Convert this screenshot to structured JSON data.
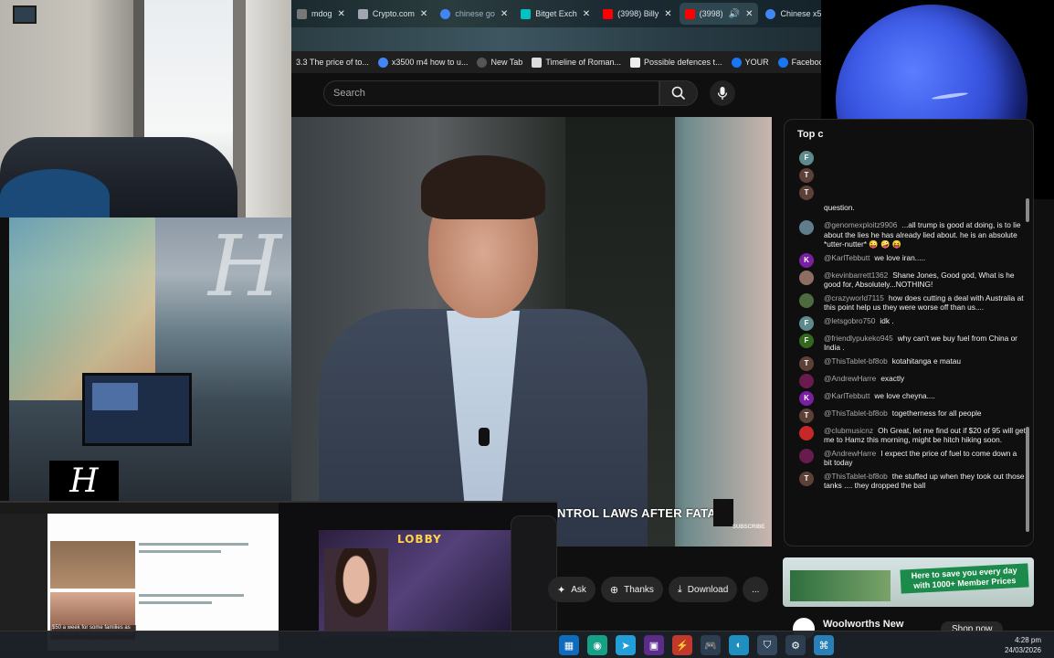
{
  "tabs": [
    {
      "label": "mdog",
      "color": "#777777"
    },
    {
      "label": "Crypto.com",
      "color": "#a1a6b4"
    },
    {
      "label": "chinese go",
      "color": "#4285f4"
    },
    {
      "label": "Bitget Exch",
      "color": "#00c2c2"
    },
    {
      "label": "(3998) Billy",
      "color": "#ff0000"
    },
    {
      "label": "(3998)",
      "color": "#ff0000"
    },
    {
      "label": "Chinese x5",
      "color": "#4285f4"
    }
  ],
  "bookmarks": [
    {
      "label": "3.3 The price of to...",
      "color": "#2e7d32"
    },
    {
      "label": "x3500 m4 how to u...",
      "color": "#4285f4"
    },
    {
      "label": "New Tab",
      "color": "#555555"
    },
    {
      "label": "Timeline of Roman...",
      "color": "#dddddd"
    },
    {
      "label": "Possible defences t...",
      "color": "#eeeeee"
    },
    {
      "label": "YOUR",
      "color": "#1877f2"
    },
    {
      "label": "Facebook green",
      "color": "#1877f2"
    }
  ],
  "search": {
    "placeholder": "Search"
  },
  "video": {
    "caption": "NTROL LAWS AFTER FATAL",
    "subscribe_mark": "SUBSCRIBE"
  },
  "mini": {
    "news_caption": "$50 a week for some families as fuel crisis relief package unveiled",
    "lobby_label": "LOBBY"
  },
  "actions": {
    "ask": "Ask",
    "thanks": "Thanks",
    "download": "Download",
    "more": "..."
  },
  "chat": {
    "header": "Top c",
    "messages": [
      {
        "avatar": "F",
        "color": "#5f8a8b",
        "author": "",
        "text": ""
      },
      {
        "avatar": "T",
        "color": "#5d4037",
        "author": "",
        "text": ""
      },
      {
        "avatar": "T",
        "color": "#5d4037",
        "author": "",
        "text": ""
      },
      {
        "avatar": "",
        "color": "#000000",
        "author": "",
        "text": "question."
      },
      {
        "avatar": "",
        "color": "#607d8b",
        "author": "@genomexploitz9906",
        "text": "...all trump is good at doing, is to lie about the lies he has already lied about. he is an absolute *utter-nutter* 😜 🤪 😝"
      },
      {
        "avatar": "K",
        "color": "#7b1fa2",
        "author": "@KarlTebbutt",
        "text": "we love iran....."
      },
      {
        "avatar": "",
        "color": "#8d6e63",
        "author": "@kevinbarrett1362",
        "text": "Shane Jones, Good god, What is he good for, Absolutely...NOTHING!"
      },
      {
        "avatar": "",
        "color": "#4e6b3f",
        "author": "@crazyworld7115",
        "text": "how does cutting a deal with Australia at this point help us they were worse off than us...."
      },
      {
        "avatar": "F",
        "color": "#5f8a8b",
        "author": "@letsgobro750",
        "text": "idk ."
      },
      {
        "avatar": "F",
        "color": "#33691e",
        "author": "@friendlypukeko945",
        "text": "why can't we buy fuel from China or India ."
      },
      {
        "avatar": "T",
        "color": "#5d4037",
        "author": "@ThisTablet-bf8ob",
        "text": "kotahitanga e matau"
      },
      {
        "avatar": "",
        "color": "#6a1b4d",
        "author": "@AndrewHarre",
        "text": "exactly"
      },
      {
        "avatar": "K",
        "color": "#7b1fa2",
        "author": "@KarlTebbutt",
        "text": "we love cheyna...."
      },
      {
        "avatar": "T",
        "color": "#5d4037",
        "author": "@ThisTablet-bf8ob",
        "text": "togetherness for all people"
      },
      {
        "avatar": "",
        "color": "#c62828",
        "author": "@clubmusicnz",
        "text": "Oh Great, let me find out if $20 of 95 will get me to Hamz this morning, might be hitch hiking soon."
      },
      {
        "avatar": "",
        "color": "#6a1b4d",
        "author": "@AndrewHarre",
        "text": "I expect the price of fuel to come down a bit today"
      },
      {
        "avatar": "T",
        "color": "#5d4037",
        "author": "@ThisTablet-bf8ob",
        "text": "the stuffed up when they took out those tanks .... they dropped the ball"
      }
    ]
  },
  "ad": {
    "promo": "Here to save you every day with 1000+ Member Prices",
    "title": "Woolworths New",
    "cta": "Shop now"
  },
  "taskbar": {
    "time": "4:28 pm",
    "date": "24/03/2026"
  }
}
